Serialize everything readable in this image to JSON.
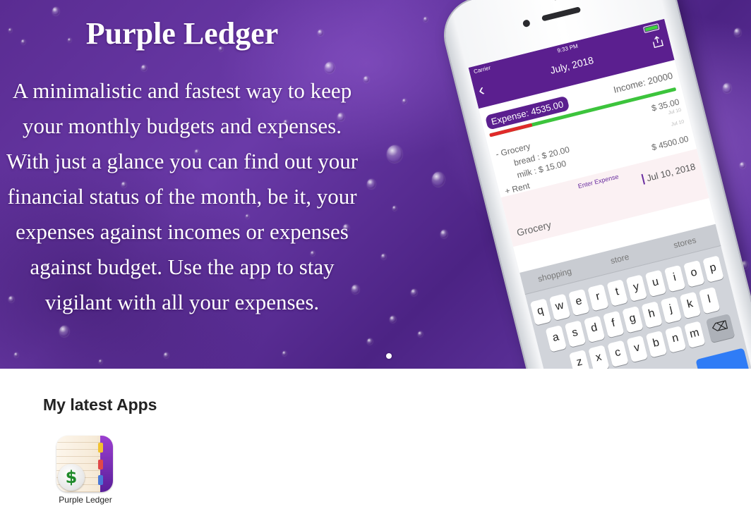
{
  "hero": {
    "title": "Purple Ledger",
    "description": "A minimalistic and fastest way to keep your monthly budgets and expenses. With just a glance you can find out your financial status of the month, be it, your expenses against incomes or expenses against budget. Use the app to stay vigilant with all your expenses.",
    "colors": {
      "background": "#5a2c92",
      "text": "#ffffff"
    },
    "slides": {
      "count": 1,
      "active": 1
    }
  },
  "phone": {
    "status": {
      "carrier": "Carrier",
      "time": "9:33 PM"
    },
    "title": "July, 2018",
    "summary": {
      "expense_label": "Expense: 4535.00",
      "income_label": "Income: 20000",
      "spent_fraction": 0.227
    },
    "entries": [
      {
        "label": "- Grocery",
        "amount": "$ 35.00",
        "date": "Jul 10"
      },
      {
        "label": "bread : $ 20.00",
        "date": "Jul 10"
      },
      {
        "label": "milk : $ 15.00"
      },
      {
        "label": "+ Rent",
        "amount": "$ 4500.00"
      }
    ],
    "entry_form": {
      "enter_label": "Enter Expense",
      "date_value": "Jul 10, 2018",
      "category_value": "Grocery"
    },
    "keyboard": {
      "suggestions": [
        "shopping",
        "store",
        "stores"
      ],
      "rows": [
        [
          "q",
          "w",
          "e",
          "r",
          "t",
          "y",
          "u",
          "i",
          "o",
          "p"
        ],
        [
          "a",
          "s",
          "d",
          "f",
          "g",
          "h",
          "j",
          "k",
          "l"
        ],
        [
          "z",
          "x",
          "c",
          "v",
          "b",
          "n",
          "m"
        ]
      ]
    },
    "colors": {
      "appbar": "#5b1f8f",
      "income_bar": "#3cc43c",
      "expense_bar": "#e02a2a"
    }
  },
  "latest": {
    "heading": "My latest Apps",
    "apps": [
      {
        "name": "Purple Ledger",
        "icon": "ledger-dollar-icon"
      }
    ]
  }
}
